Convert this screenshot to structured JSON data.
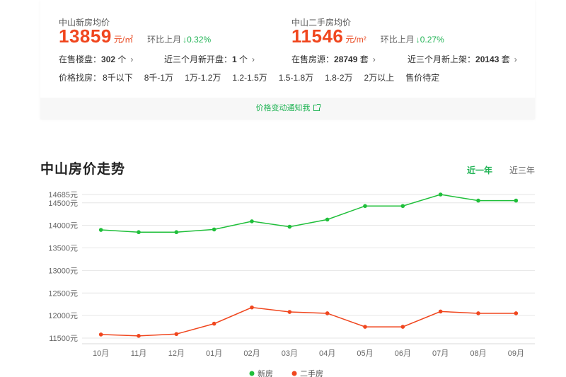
{
  "summary": {
    "new_home": {
      "label": "中山新房均价",
      "price": "13859",
      "unit": "元/㎡",
      "mom_label": "环比上月",
      "mom_value": "↓0.32%",
      "stat1_label": "在售楼盘：",
      "stat1_value": "302",
      "stat1_unit": " 个",
      "stat2_label": "近三个月新开盘：",
      "stat2_value": "1",
      "stat2_unit": " 个"
    },
    "used_home": {
      "label": "中山二手房均价",
      "price": "11546",
      "unit": "元/m²",
      "mom_label": "环比上月",
      "mom_value": "↓0.27%",
      "stat1_label": "在售房源：",
      "stat1_value": "28749",
      "stat1_unit": " 套",
      "stat2_label": "近三个月新上架：",
      "stat2_value": "20143",
      "stat2_unit": " 套"
    },
    "price_filter": {
      "label": "价格找房：",
      "options": [
        "8千以下",
        "8千-1万",
        "1万-1.2万",
        "1.2-1.5万",
        "1.5-1.8万",
        "1.8-2万",
        "2万以上",
        "售价待定"
      ]
    },
    "notify_label": "价格变动通知我"
  },
  "trend": {
    "title": "中山房价走势",
    "tabs": [
      "近一年",
      "近三年"
    ],
    "active_tab": 0
  },
  "chart_data": {
    "type": "line",
    "categories": [
      "10月",
      "11月",
      "12月",
      "01月",
      "02月",
      "03月",
      "04月",
      "05月",
      "06月",
      "07月",
      "08月",
      "09月"
    ],
    "y_ticks": [
      "11500元",
      "12000元",
      "12500元",
      "13000元",
      "13500元",
      "14000元",
      "14500元",
      "14685元"
    ],
    "ylim": [
      11500,
      14685
    ],
    "series": [
      {
        "name": "新房",
        "color": "#1fbf3a",
        "values": [
          13900,
          13850,
          13850,
          13910,
          14090,
          13970,
          14130,
          14430,
          14430,
          14685,
          14550,
          14550
        ]
      },
      {
        "name": "二手房",
        "color": "#f0461e",
        "values": [
          11580,
          11550,
          11590,
          11820,
          12180,
          12080,
          12050,
          11750,
          11750,
          12090,
          12050,
          12050
        ]
      }
    ],
    "legend_position": "bottom-center",
    "grid": true
  }
}
